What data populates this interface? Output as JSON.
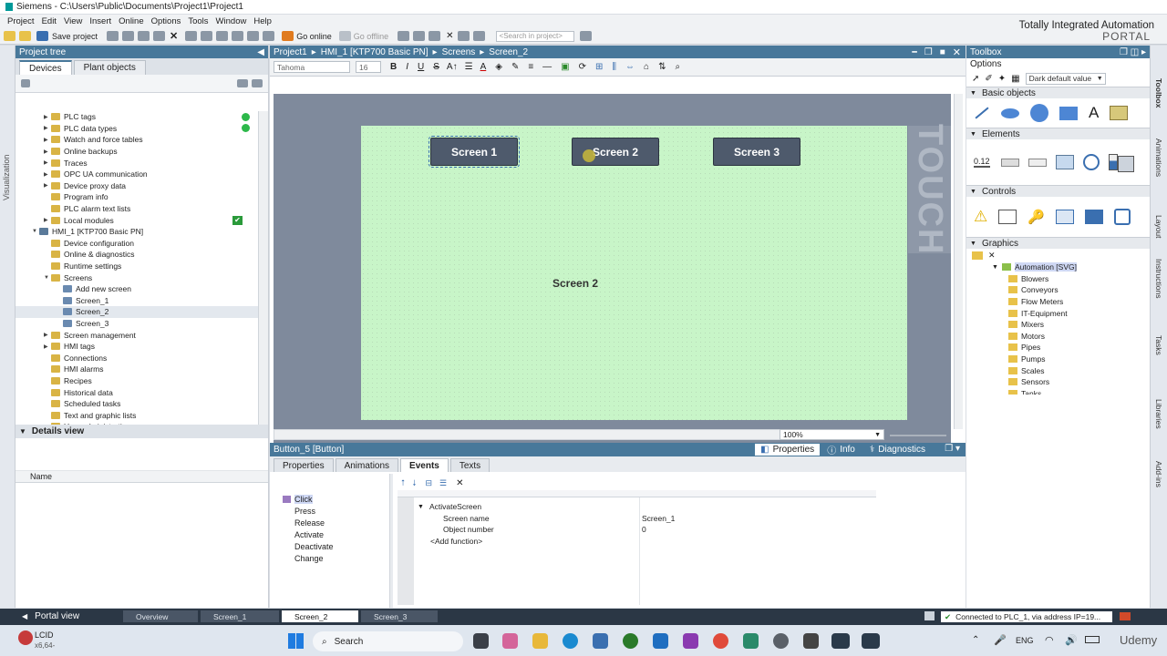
{
  "window_title": "Siemens  -  C:\\Users\\Public\\Documents\\Project1\\Project1",
  "menu": [
    "Project",
    "Edit",
    "View",
    "Insert",
    "Online",
    "Options",
    "Tools",
    "Window",
    "Help"
  ],
  "toolbar": {
    "save_label": "Save project",
    "go_online": "Go online",
    "go_offline": "Go offline",
    "search_placeholder": "<Search in project>"
  },
  "brand": {
    "line1": "Totally Integrated Automation",
    "line2": "PORTAL"
  },
  "left_strip_label": "Visualization",
  "project_tree": {
    "title": "Project tree",
    "tabs": [
      "Devices",
      "Plant objects"
    ],
    "items": [
      {
        "label": "PLC tags",
        "level": 2,
        "arrow": true,
        "status": "green"
      },
      {
        "label": "PLC data types",
        "level": 2,
        "arrow": true,
        "status": "green"
      },
      {
        "label": "Watch and force tables",
        "level": 2,
        "arrow": true
      },
      {
        "label": "Online backups",
        "level": 2,
        "arrow": true
      },
      {
        "label": "Traces",
        "level": 2,
        "arrow": true
      },
      {
        "label": "OPC UA communication",
        "level": 2,
        "arrow": true
      },
      {
        "label": "Device proxy data",
        "level": 2,
        "arrow": true
      },
      {
        "label": "Program info",
        "level": 2
      },
      {
        "label": "PLC alarm text lists",
        "level": 2
      },
      {
        "label": "Local modules",
        "level": 2,
        "arrow": true,
        "status": "check"
      },
      {
        "label": "HMI_1 [KTP700 Basic PN]",
        "level": 1,
        "arrow": "open"
      },
      {
        "label": "Device configuration",
        "level": 2
      },
      {
        "label": "Online & diagnostics",
        "level": 2
      },
      {
        "label": "Runtime settings",
        "level": 2
      },
      {
        "label": "Screens",
        "level": 2,
        "arrow": "open"
      },
      {
        "label": "Add new screen",
        "level": 3
      },
      {
        "label": "Screen_1",
        "level": 3
      },
      {
        "label": "Screen_2",
        "level": 3,
        "selected": true
      },
      {
        "label": "Screen_3",
        "level": 3
      },
      {
        "label": "Screen management",
        "level": 2,
        "arrow": true
      },
      {
        "label": "HMI tags",
        "level": 2,
        "arrow": true
      },
      {
        "label": "Connections",
        "level": 2
      },
      {
        "label": "HMI alarms",
        "level": 2
      },
      {
        "label": "Recipes",
        "level": 2
      },
      {
        "label": "Historical data",
        "level": 2
      },
      {
        "label": "Scheduled tasks",
        "level": 2
      },
      {
        "label": "Text and graphic lists",
        "level": 2
      },
      {
        "label": "User administration",
        "level": 2
      }
    ]
  },
  "details_view": {
    "title": "Details view",
    "column": "Name"
  },
  "editor": {
    "breadcrumb": [
      "Project1",
      "HMI_1 [KTP700 Basic PN]",
      "Screens",
      "Screen_2"
    ],
    "font": "Tahoma",
    "font_size": "16",
    "screen_buttons": [
      "Screen 1",
      "Screen 2",
      "Screen 3"
    ],
    "screen_title": "Screen 2",
    "touch_label": "TOUCH",
    "zoom": "100%"
  },
  "properties": {
    "object": "Button_5 [Button]",
    "right_tabs": [
      "Properties",
      "Info",
      "Diagnostics"
    ],
    "tabs": [
      "Properties",
      "Animations",
      "Events",
      "Texts"
    ],
    "active_tab": "Events",
    "events": [
      "Click",
      "Press",
      "Release",
      "Activate",
      "Deactivate",
      "Change"
    ],
    "function": "ActivateScreen",
    "params": [
      {
        "name": "Screen name",
        "value": "Screen_1"
      },
      {
        "name": "Object number",
        "value": "0"
      }
    ],
    "add_function": "<Add function>"
  },
  "toolbox": {
    "title": "Toolbox",
    "options_label": "Options",
    "style_select": "Dark default value",
    "sections": [
      "Basic objects",
      "Elements",
      "Controls",
      "Graphics"
    ],
    "graphics_root": "Automation [SVG]",
    "graphics_items": [
      "Blowers",
      "Conveyors",
      "Flow Meters",
      "IT-Equipment",
      "Mixers",
      "Motors",
      "Pipes",
      "Pumps",
      "Scales",
      "Sensors",
      "Tanks"
    ]
  },
  "right_strip": [
    "Toolbox",
    "Animations",
    "Layout",
    "Instructions",
    "Tasks",
    "Libraries",
    "Add-ins"
  ],
  "statusbar": {
    "portal_view": "Portal view",
    "tabs": [
      "Overview",
      "Screen_1",
      "Screen_2",
      "Screen_3"
    ],
    "active_tab": "Screen_2",
    "connection": "Connected to PLC_1, via address IP=19..."
  },
  "taskbar": {
    "weather": "LCID",
    "weather_sub": "x6,64-",
    "search": "Search",
    "lang": "ENG",
    "udemy": "Udemy"
  }
}
